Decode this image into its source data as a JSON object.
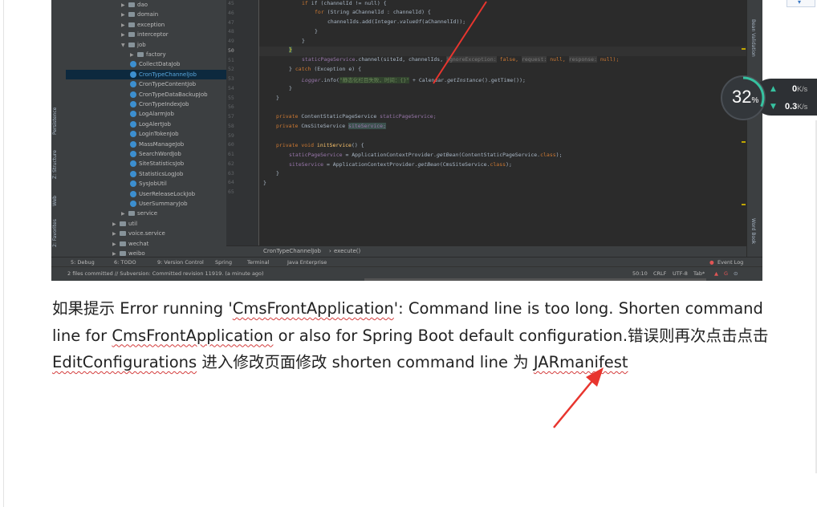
{
  "ide": {
    "left_tool_windows": [
      "Persistence",
      "Z: Structure",
      "Web",
      "2: Favorites"
    ],
    "right_tool_windows": [
      "Bean Validation",
      "Word Book"
    ],
    "tree": [
      {
        "label": "dao",
        "type": "folder",
        "indent": 1,
        "expanded": false
      },
      {
        "label": "domain",
        "type": "folder",
        "indent": 1,
        "expanded": false
      },
      {
        "label": "exception",
        "type": "folder",
        "indent": 1,
        "expanded": false
      },
      {
        "label": "interceptor",
        "type": "folder",
        "indent": 1,
        "expanded": false
      },
      {
        "label": "job",
        "type": "folder",
        "indent": 1,
        "expanded": true
      },
      {
        "label": "factory",
        "type": "folder",
        "indent": 2,
        "expanded": false
      },
      {
        "label": "CollectDataJob",
        "type": "class",
        "indent": 2
      },
      {
        "label": "CronTypeChannelJob",
        "type": "class",
        "indent": 2,
        "selected": true
      },
      {
        "label": "CronTypeContentJob",
        "type": "class",
        "indent": 2
      },
      {
        "label": "CronTypeDataBackupJob",
        "type": "class",
        "indent": 2
      },
      {
        "label": "CronTypeIndexJob",
        "type": "class",
        "indent": 2
      },
      {
        "label": "LogAlarmJob",
        "type": "class",
        "indent": 2
      },
      {
        "label": "LogAlertJob",
        "type": "class",
        "indent": 2
      },
      {
        "label": "LoginTokenJob",
        "type": "class",
        "indent": 2
      },
      {
        "label": "MassManageJob",
        "type": "class",
        "indent": 2
      },
      {
        "label": "SearchWordJob",
        "type": "class",
        "indent": 2
      },
      {
        "label": "SiteStatisticsJob",
        "type": "class",
        "indent": 2
      },
      {
        "label": "StatisticsLogJob",
        "type": "class",
        "indent": 2
      },
      {
        "label": "SysJobUtil",
        "type": "class",
        "indent": 2
      },
      {
        "label": "UserReleaseLockJob",
        "type": "class",
        "indent": 2
      },
      {
        "label": "UserSummaryJob",
        "type": "class",
        "indent": 2
      },
      {
        "label": "service",
        "type": "folder",
        "indent": 1,
        "expanded": false
      },
      {
        "label": "util",
        "type": "folder",
        "indent": 0,
        "expanded": false
      },
      {
        "label": "voice.service",
        "type": "folder",
        "indent": 0,
        "expanded": false
      },
      {
        "label": "wechat",
        "type": "folder",
        "indent": 0,
        "expanded": false
      },
      {
        "label": "weibo",
        "type": "folder",
        "indent": 0,
        "expanded": false
      }
    ],
    "line_numbers": [
      "45",
      "46",
      "47",
      "48",
      "49",
      "50",
      "51",
      "52",
      "53",
      "54",
      "55",
      "56",
      "57",
      "58",
      "59",
      "60",
      "61",
      "62",
      "63",
      "64",
      "65"
    ],
    "current_line": "50",
    "code": {
      "l45": "if (channelId != null) {",
      "l46_kw": "for",
      "l46": "(String aChannelId : channelId) {",
      "l47_a": "channelIds.add(Integer.",
      "l47_b": "valueOf",
      "l47_c": "(aChannelId));",
      "l48": "}",
      "l49": "}",
      "l50": "}",
      "l51_a": "staticPageService",
      "l51_b": ".channel(siteId, channelIds,",
      "l51_h1": "ignoreException:",
      "l51_v1": "false,",
      "l51_h2": "request:",
      "l51_v2": "null,",
      "l51_h3": "response:",
      "l51_v3": "null);",
      "l52_a": "} ",
      "l52_kw": "catch",
      "l52_b": " (Exception e) {",
      "l53_a": "Logger",
      "l53_b": ".info(",
      "l53_str": "\"静态化栏目失败，时间：{}\"",
      "l53_c": " + Calendar.",
      "l53_d": "getInstance",
      "l53_e": "().getTime());",
      "l54": "}",
      "l55": "}",
      "l57_kw": "private",
      "l57_a": "ContentStaticPageService",
      "l57_f": "staticPageService;",
      "l58_kw": "private",
      "l58_a": "CmsSiteService",
      "l58_f": "siteService;",
      "l60_kw1": "private",
      "l60_kw2": "void",
      "l60_fn": "initService",
      "l60_b": "() {",
      "l61_f": "staticPageService",
      "l61_a": " = ApplicationContextProvider.",
      "l61_s": "getBean",
      "l61_b": "(ContentStaticPageService.",
      "l61_kw": "class",
      "l61_c": ");",
      "l62_f": "siteService",
      "l62_a": " = ApplicationContextProvider.",
      "l62_s": "getBean",
      "l62_b": "(CmsSiteService.",
      "l62_kw": "class",
      "l62_c": ");",
      "l63": "}",
      "l64": "}"
    },
    "breadcrumb": [
      "CronTypeChannelJob",
      "execute()"
    ],
    "bottom_tabs": [
      "5: Debug",
      "6: TODO",
      "9: Version Control",
      "Spring",
      "Terminal",
      "Java Enterprise"
    ],
    "event_log": "Event Log",
    "status_message": "2 files committed // Subversion: Committed revision 11919. (a minute ago)",
    "status_right": [
      "50:10",
      "CRLF",
      "UTF-8",
      "Tab*"
    ]
  },
  "network_widget": {
    "percent": "32",
    "percent_sign": "%",
    "percent_value": 0.32,
    "upload_value": "0",
    "upload_unit": "K/s",
    "download_value": "0.3",
    "download_unit": "K/s"
  },
  "document": {
    "seg1": "如果提示 Error running '",
    "seg2": "CmsFrontApplication",
    "seg3": "': Command line is too long. Shorten command line for ",
    "seg4": "CmsFrontApplication",
    "seg5": " or also for Spring Boot default configuration.错误则再次点击点击 ",
    "seg6": "EditConfigurations",
    "seg7": " 进入修改页面修改 shorten command line  为 ",
    "seg8": "JARmanifest"
  },
  "colors": {
    "annotation_arrow": "#e8352e",
    "ide_background": "#2b2b2b",
    "selection": "#0d293e"
  }
}
